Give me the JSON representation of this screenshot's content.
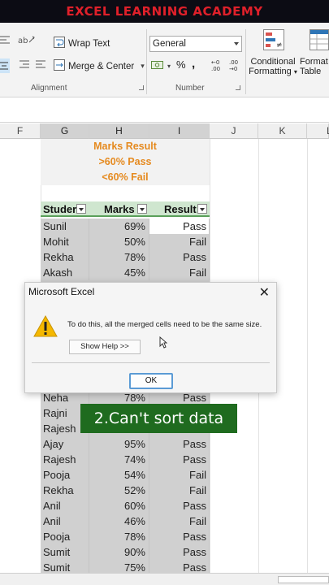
{
  "banner": {
    "title": "EXCEL LEARNING ACADEMY"
  },
  "ribbon": {
    "wrap_text": "Wrap Text",
    "merge_center": "Merge & Center",
    "alignment_label": "Alignment",
    "number_format_value": "General",
    "currency_symbol": "$",
    "percent_symbol": "%",
    "comma_symbol": ",",
    "number_label": "Number",
    "conditional_formatting_line1": "Conditional",
    "conditional_formatting_line2": "Formatting",
    "format_table_line1": "Format",
    "format_table_line2": "Table"
  },
  "columns": [
    "F",
    "G",
    "H",
    "I",
    "J",
    "K",
    "L"
  ],
  "legend": {
    "line1": "Marks  Result",
    "line2": ">60%  Pass",
    "line3": "<60%  Fail"
  },
  "table": {
    "headers": [
      "Studer",
      "Marks",
      "Result"
    ],
    "rows_top": [
      {
        "name": "Sunil",
        "marks": "69%",
        "result": "Pass"
      },
      {
        "name": "Mohit",
        "marks": "50%",
        "result": "Fail"
      },
      {
        "name": "Rekha",
        "marks": "78%",
        "result": "Pass"
      },
      {
        "name": "Akash",
        "marks": "45%",
        "result": "Fail"
      }
    ],
    "rows_bottom": [
      {
        "name": "Neha",
        "marks": "78%",
        "result": "Pass"
      },
      {
        "name": "Rajni",
        "marks": "",
        "result": ""
      },
      {
        "name": "Rajesh",
        "marks": "",
        "result": ""
      },
      {
        "name": "Ajay",
        "marks": "95%",
        "result": "Pass"
      },
      {
        "name": "Rajesh",
        "marks": "74%",
        "result": "Pass"
      },
      {
        "name": "Pooja",
        "marks": "54%",
        "result": "Fail"
      },
      {
        "name": "Rekha",
        "marks": "52%",
        "result": "Fail"
      },
      {
        "name": "Anil",
        "marks": "60%",
        "result": "Pass"
      },
      {
        "name": "Anil",
        "marks": "46%",
        "result": "Fail"
      },
      {
        "name": "Pooja",
        "marks": "78%",
        "result": "Pass"
      },
      {
        "name": "Sumit",
        "marks": "90%",
        "result": "Pass"
      },
      {
        "name": "Sumit",
        "marks": "75%",
        "result": "Pass"
      }
    ]
  },
  "dialog": {
    "title": "Microsoft Excel",
    "close": "✕",
    "message": "To do this, all the merged cells need to be the same size.",
    "show_help": "Show Help >>",
    "ok": "OK"
  },
  "caption": {
    "text": "2.Can't sort data"
  },
  "colors": {
    "accent_green": "#1f6b1f",
    "header_green": "#cfe6cf",
    "orange": "#e58a1f",
    "banner_red": "#e0202a"
  }
}
